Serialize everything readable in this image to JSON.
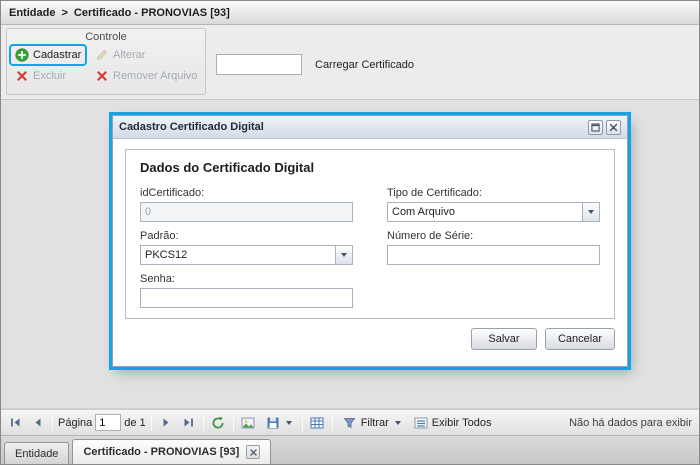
{
  "colors": {
    "annotation_highlight": "#14a3e4",
    "add_icon_green": "#3aa13a",
    "delete_icon_red": "#d23b34"
  },
  "breadcrumb": {
    "root": "Entidade",
    "separator": ">",
    "current": "Certificado - PRONOVIAS [93]"
  },
  "toolbar": {
    "group_title": "Controle",
    "cadastrar_label": "Cadastrar",
    "alterar_label": "Alterar",
    "excluir_label": "Excluir",
    "remover_label": "Remover Arquivo",
    "upload_value": "",
    "upload_label": "Carregar Certificado"
  },
  "modal": {
    "title": "Cadastro Certificado Digital",
    "section_title": "Dados do Certificado Digital",
    "id_label": "idCertificado:",
    "id_value": "0",
    "tipo_label": "Tipo de Certificado:",
    "tipo_value": "Com Arquivo",
    "padrao_label": "Padrão:",
    "padrao_value": "PKCS12",
    "serie_label": "Número de Série:",
    "serie_value": "",
    "senha_label": "Senha:",
    "senha_value": "",
    "salvar_label": "Salvar",
    "cancelar_label": "Cancelar"
  },
  "paging": {
    "page_label": "Página",
    "page_value": "1",
    "of_label": "de 1",
    "filtrar_label": "Filtrar",
    "exibir_label": "Exibir Todos",
    "status": "Não há dados para exibir"
  },
  "tabs": {
    "entidade": "Entidade",
    "certificado": "Certificado - PRONOVIAS [93]"
  },
  "icons": {
    "add": "green-plus-circle",
    "edit": "pencil",
    "delete": "red-x",
    "remove_file": "red-x",
    "maximize": "box-outline",
    "close": "x",
    "first_page": "bar-left-triangle",
    "prev_page": "left-triangle",
    "next_page": "right-triangle",
    "last_page": "right-triangle-bar",
    "refresh": "circular-arrow",
    "export": "picture",
    "export_menu": "disk-with-arrow",
    "grid": "table-grid",
    "filter": "funnel",
    "show_all": "list",
    "combo_arrow": "▼"
  }
}
